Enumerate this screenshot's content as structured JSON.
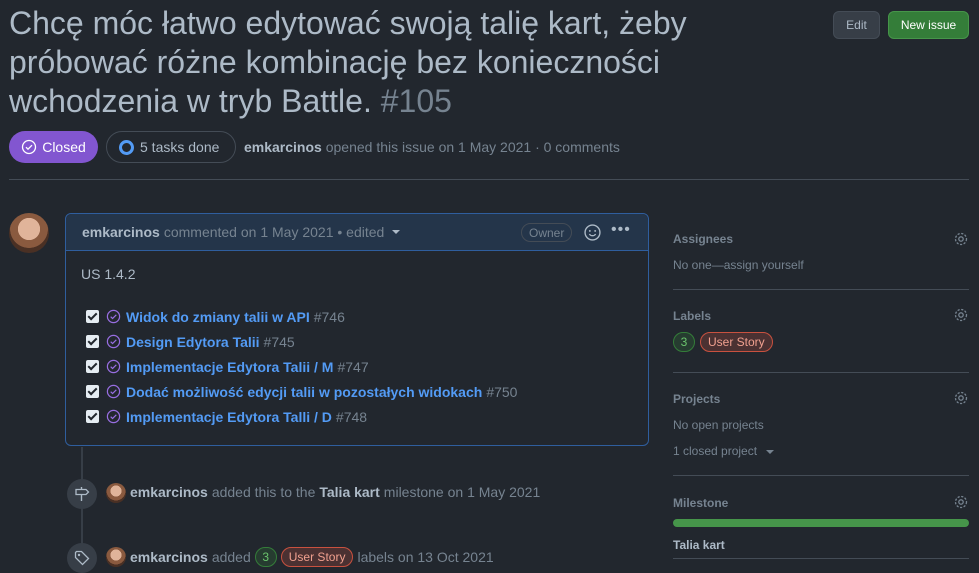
{
  "issue": {
    "title": "Chcę móc łatwo edytować swoją talię kart, żeby próbować różne kombinację bez konieczności wchodzenia w tryb Battle.",
    "number": "#105",
    "state": "Closed",
    "tasks_done": "5 tasks done",
    "author": "emkarcinos",
    "opened_text": "opened this issue on 1 May 2021 · 0 comments"
  },
  "header_actions": {
    "edit_label": "Edit",
    "new_issue_label": "New issue"
  },
  "comment": {
    "author": "emkarcinos",
    "meta": "commented on 1 May 2021 • edited",
    "owner_badge": "Owner",
    "body_heading": "US 1.4.2",
    "tasks": [
      {
        "label": "Widok do zmiany talii w API",
        "ref": "#746"
      },
      {
        "label": "Design Edytora Talii",
        "ref": "#745"
      },
      {
        "label": "Implementacje Edytora Talii / M",
        "ref": "#747"
      },
      {
        "label": "Dodać możliwość edycji talii w pozostałych widokach",
        "ref": "#750"
      },
      {
        "label": "Implementacje Edytora Talli / D",
        "ref": "#748"
      }
    ]
  },
  "timeline": [
    {
      "actor": "emkarcinos",
      "text_before": "added this to the",
      "milestone": "Talia kart",
      "text_after": "milestone on 1 May 2021",
      "icon": "milestone-icon"
    },
    {
      "actor": "emkarcinos",
      "text_before": "added",
      "count": "3",
      "label": "User Story",
      "text_after": "labels on 13 Oct 2021",
      "icon": "tag-icon"
    }
  ],
  "sidebar": {
    "assignees": {
      "title": "Assignees",
      "value": "No one—assign yourself"
    },
    "labels": {
      "title": "Labels",
      "count": "3",
      "label": "User Story"
    },
    "projects": {
      "title": "Projects",
      "value": "No open projects",
      "closed": "1 closed project"
    },
    "milestone": {
      "title": "Milestone",
      "name": "Talia kart",
      "progress": 1.0
    }
  },
  "colors": {
    "closed": "#8256d0",
    "link": "#539bf5",
    "green": "#347d39",
    "label_red": "#c9513f"
  }
}
